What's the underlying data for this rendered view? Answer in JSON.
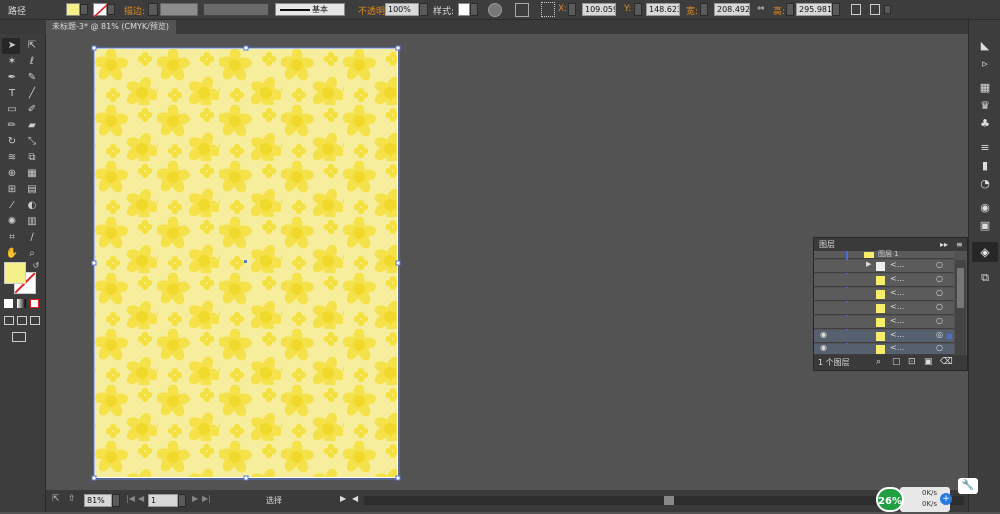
{
  "control_bar": {
    "label_path": "路径",
    "stroke_label": "描边:",
    "stroke_style": "基本",
    "opacity_label": "不透明度:",
    "opacity_value": "100%",
    "style_label": "样式:",
    "x_label": "X:",
    "x_value": "109.059",
    "y_label": "Y:",
    "y_value": "148.623",
    "w_label": "宽:",
    "w_value": "208.492",
    "h_label": "高:",
    "h_value": "295.981",
    "fill_color": "#f6f08a",
    "accent_color": "#e08a1e"
  },
  "document": {
    "tab_title": "未标题-3* @ 81% (CMYK/预览)"
  },
  "status": {
    "zoom": "81%",
    "page": "1",
    "mode": "选择"
  },
  "layers_panel": {
    "title": "图层",
    "layer_name": "图层 1",
    "sublayer_label": "<...",
    "footer": "1 个图层"
  },
  "badge": {
    "percent": "26%",
    "up": "0K/s",
    "down": "0K/s"
  }
}
